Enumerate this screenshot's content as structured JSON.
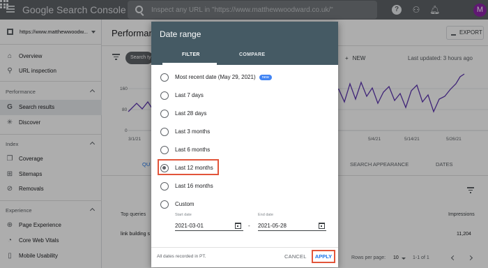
{
  "topbar": {
    "logo": "Google Search Console",
    "search_placeholder": "Inspect any URL in \"https://www.matthewwoodward.co.uk/\"",
    "avatar_letter": "M",
    "help_label": "?"
  },
  "sidebar": {
    "property": "https://www.matthewwoodw...",
    "items_top": [
      {
        "label": "Overview",
        "icon": "home-icon"
      },
      {
        "label": "URL inspection",
        "icon": "search-icon"
      }
    ],
    "sections": [
      {
        "label": "Performance",
        "items": [
          {
            "label": "Search results",
            "icon": "google-icon",
            "active": true
          },
          {
            "label": "Discover",
            "icon": "asterisk-icon"
          }
        ]
      },
      {
        "label": "Index",
        "items": [
          {
            "label": "Coverage",
            "icon": "file-copy-icon"
          },
          {
            "label": "Sitemaps",
            "icon": "sitemap-icon"
          },
          {
            "label": "Removals",
            "icon": "eye-off-icon"
          }
        ]
      },
      {
        "label": "Experience",
        "items": [
          {
            "label": "Page Experience",
            "icon": "plus-circle-icon"
          },
          {
            "label": "Core Web Vitals",
            "icon": "speed-icon"
          },
          {
            "label": "Mobile Usability",
            "icon": "phone-icon"
          }
        ]
      }
    ]
  },
  "main": {
    "title": "Performanc",
    "export_label": "EXPORT",
    "chip_label": "Search ty",
    "new_label": "NEW",
    "last_updated": "Last updated: 3 hours ago",
    "chart": {
      "y_ticks": [
        "160",
        "80",
        "0"
      ],
      "x_ticks_left": [
        "3/1/21"
      ],
      "x_ticks_right": [
        "5/4/21",
        "5/14/21",
        "5/26/21"
      ]
    },
    "tabs": {
      "left_partial": "QU",
      "appearance": "SEARCH APPEARANCE",
      "dates": "DATES"
    },
    "table": {
      "col_queries": "Top queries",
      "col_impressions": "Impressions",
      "row_query": "link building s",
      "row_impressions": "11,204"
    },
    "pager": {
      "rows_per_page_label": "Rows per page:",
      "rows_per_page_value": "10",
      "range": "1-1 of 1"
    }
  },
  "dialog": {
    "title": "Date range",
    "tabs": [
      "FILTER",
      "COMPARE"
    ],
    "options": [
      {
        "label": "Most recent date (May 29, 2021)",
        "badge": "new",
        "checked": false
      },
      {
        "label": "Last 7 days",
        "checked": false
      },
      {
        "label": "Last 28 days",
        "checked": false
      },
      {
        "label": "Last 3 months",
        "checked": false
      },
      {
        "label": "Last 6 months",
        "checked": false
      },
      {
        "label": "Last 12 months",
        "checked": true
      },
      {
        "label": "Last 16 months",
        "checked": false
      },
      {
        "label": "Custom",
        "checked": false
      }
    ],
    "start_label": "Start date",
    "start_value": "2021-03-01",
    "end_label": "End date",
    "end_value": "2021-05-28",
    "range_dash": "-",
    "footer_note": "All dates recorded in PT.",
    "cancel_label": "CANCEL",
    "apply_label": "APPLY"
  },
  "colors": {
    "topbar": "#5f6368",
    "dialog_header": "#455a64",
    "highlight_box": "#e2553a",
    "new_badge": "#4285f4",
    "chart_line": "#5e35b1"
  }
}
